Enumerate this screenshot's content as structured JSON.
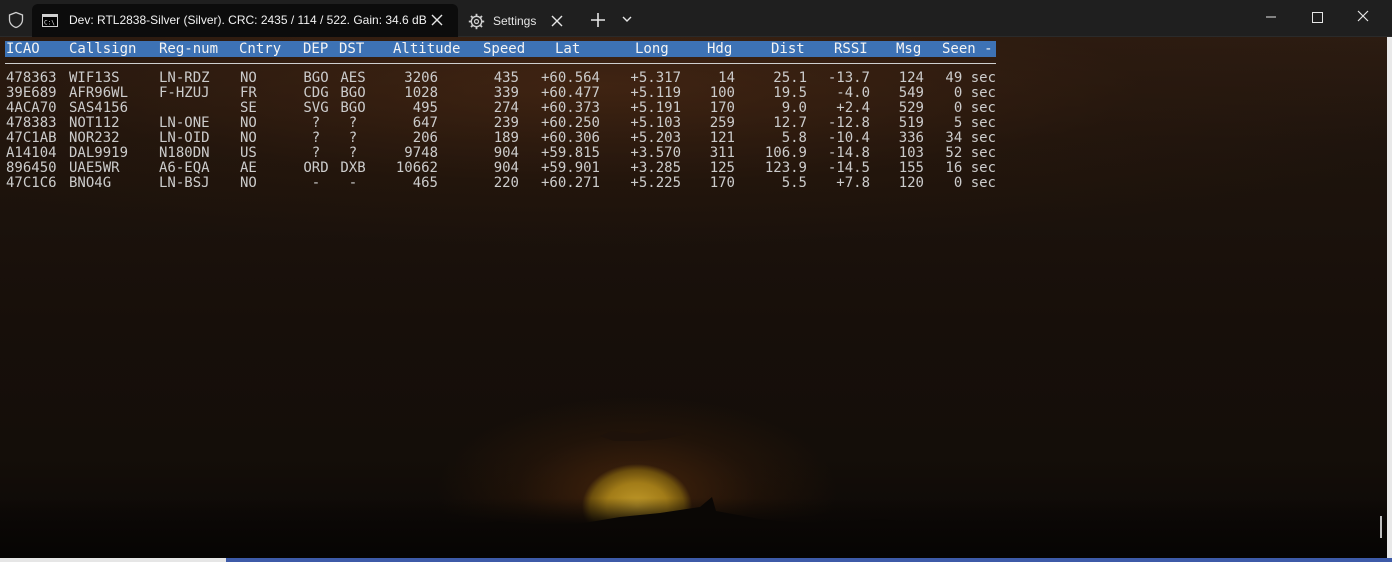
{
  "window": {
    "tabs": [
      {
        "title": "Dev: RTL2838-Silver (Silver). CRC: 2435 / 114 / 522. Gain: 34.6 dB",
        "icon": "command-prompt-icon"
      },
      {
        "title": "Settings",
        "icon": "gear-icon"
      }
    ]
  },
  "table": {
    "columns": [
      "ICAO",
      "Callsign",
      "Reg-num",
      "Cntry",
      "DEP",
      "DST",
      "Altitude",
      "Speed",
      "Lat",
      "Long",
      "Hdg",
      "Dist",
      "RSSI",
      "Msg",
      "Seen -"
    ],
    "rows": [
      [
        "478363",
        "WIF13S",
        "LN-RDZ",
        "NO",
        "BGO",
        "AES",
        "3206",
        "435",
        "+60.564",
        "+5.317",
        "14",
        "25.1",
        "-13.7",
        "124",
        "49 sec"
      ],
      [
        "39E689",
        "AFR96WL",
        "F-HZUJ",
        "FR",
        "CDG",
        "BGO",
        "1028",
        "339",
        "+60.477",
        "+5.119",
        "100",
        "19.5",
        "-4.0",
        "549",
        "0 sec"
      ],
      [
        "4ACA70",
        "SAS4156",
        "",
        "SE",
        "SVG",
        "BGO",
        "495",
        "274",
        "+60.373",
        "+5.191",
        "170",
        "9.0",
        "+2.4",
        "529",
        "0 sec"
      ],
      [
        "478383",
        "NOT112",
        "LN-ONE",
        "NO",
        "?",
        "?",
        "647",
        "239",
        "+60.250",
        "+5.103",
        "259",
        "12.7",
        "-12.8",
        "519",
        "5 sec"
      ],
      [
        "47C1AB",
        "NOR232",
        "LN-OID",
        "NO",
        "?",
        "?",
        "206",
        "189",
        "+60.306",
        "+5.203",
        "121",
        "5.8",
        "-10.4",
        "336",
        "34 sec"
      ],
      [
        "A14104",
        "DAL9919",
        "N180DN",
        "US",
        "?",
        "?",
        "9748",
        "904",
        "+59.815",
        "+3.570",
        "311",
        "106.9",
        "-14.8",
        "103",
        "52 sec"
      ],
      [
        "896450",
        "UAE5WR",
        "A6-EQA",
        "AE",
        "ORD",
        "DXB",
        "10662",
        "904",
        "+59.901",
        "+3.285",
        "125",
        "123.9",
        "-14.5",
        "155",
        "16 sec"
      ],
      [
        "47C1C6",
        "BNO4G",
        "LN-BSJ",
        "NO",
        "-",
        "-",
        "465",
        "220",
        "+60.271",
        "+5.225",
        "170",
        "5.5",
        "+7.8",
        "120",
        "0 sec"
      ]
    ]
  },
  "colors": {
    "header_highlight": "#3d72b5",
    "terminal_text": "#cccccc",
    "titlebar_bg": "#1f1f1f"
  }
}
